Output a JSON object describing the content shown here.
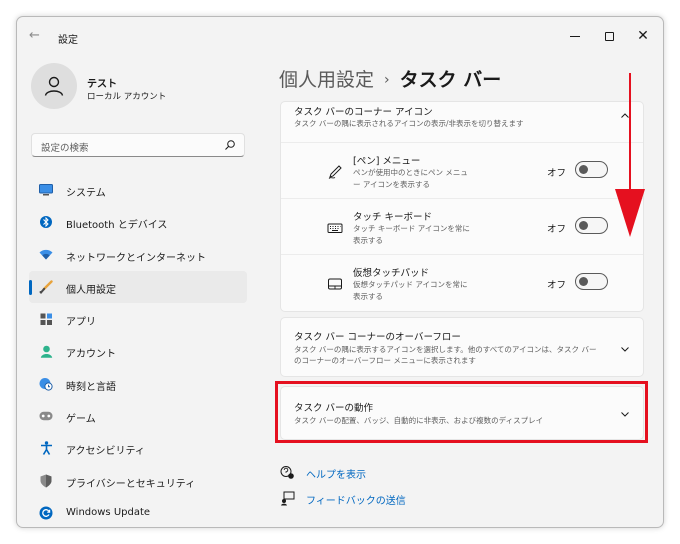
{
  "window": {
    "title": "設定",
    "back_glyph": "←",
    "close_glyph": "✕"
  },
  "profile": {
    "name": "テスト",
    "account_type": "ローカル アカウント"
  },
  "search": {
    "placeholder": "設定の検索"
  },
  "sidebar": {
    "items": [
      {
        "label": "システム",
        "icon": "system-icon"
      },
      {
        "label": "Bluetooth とデバイス",
        "icon": "bluetooth-icon"
      },
      {
        "label": "ネットワークとインターネット",
        "icon": "wifi-icon"
      },
      {
        "label": "個人用設定",
        "icon": "brush-icon",
        "active": true
      },
      {
        "label": "アプリ",
        "icon": "apps-icon"
      },
      {
        "label": "アカウント",
        "icon": "account-icon"
      },
      {
        "label": "時刻と言語",
        "icon": "globe-clock-icon"
      },
      {
        "label": "ゲーム",
        "icon": "gamepad-icon"
      },
      {
        "label": "アクセシビリティ",
        "icon": "accessibility-icon"
      },
      {
        "label": "プライバシーとセキュリティ",
        "icon": "shield-icon"
      },
      {
        "label": "Windows Update",
        "icon": "update-icon"
      }
    ]
  },
  "breadcrumb": {
    "parent": "個人用設定",
    "separator": "›",
    "current": "タスク バー"
  },
  "corner_icons": {
    "title": "タスク バーのコーナー アイコン",
    "description": "タスク バーの隅に表示されるアイコンの表示/非表示を切り替えます",
    "items": [
      {
        "title": "[ペン] メニュー",
        "description": "ペンが使用中のときにペン メニュー アイコンを表示する",
        "toggle_label": "オフ",
        "on": false,
        "icon": "pen-icon"
      },
      {
        "title": "タッチ キーボード",
        "description": "タッチ キーボード アイコンを常に表示する",
        "toggle_label": "オフ",
        "on": false,
        "icon": "keyboard-icon"
      },
      {
        "title": "仮想タッチパッド",
        "description": "仮想タッチパッド アイコンを常に表示する",
        "toggle_label": "オフ",
        "on": false,
        "icon": "touchpad-icon"
      }
    ]
  },
  "overflow": {
    "title": "タスク バー コーナーのオーバーフロー",
    "description_line1": "タスク バーの隅に表示するアイコンを選択します。他のすべてのアイコンは、タスク バー",
    "description_line2": "のコーナーのオーバーフロー メニューに表示されます"
  },
  "behavior": {
    "title": "タスク バーの動作",
    "description": "タスク バーの配置、バッジ、自動的に非表示、および複数のディスプレイ"
  },
  "links": {
    "help": "ヘルプを表示",
    "feedback": "フィードバックの送信"
  },
  "colors": {
    "accent": "#0067c0",
    "highlight": "#e5101f",
    "arrow": "#e5101f"
  }
}
